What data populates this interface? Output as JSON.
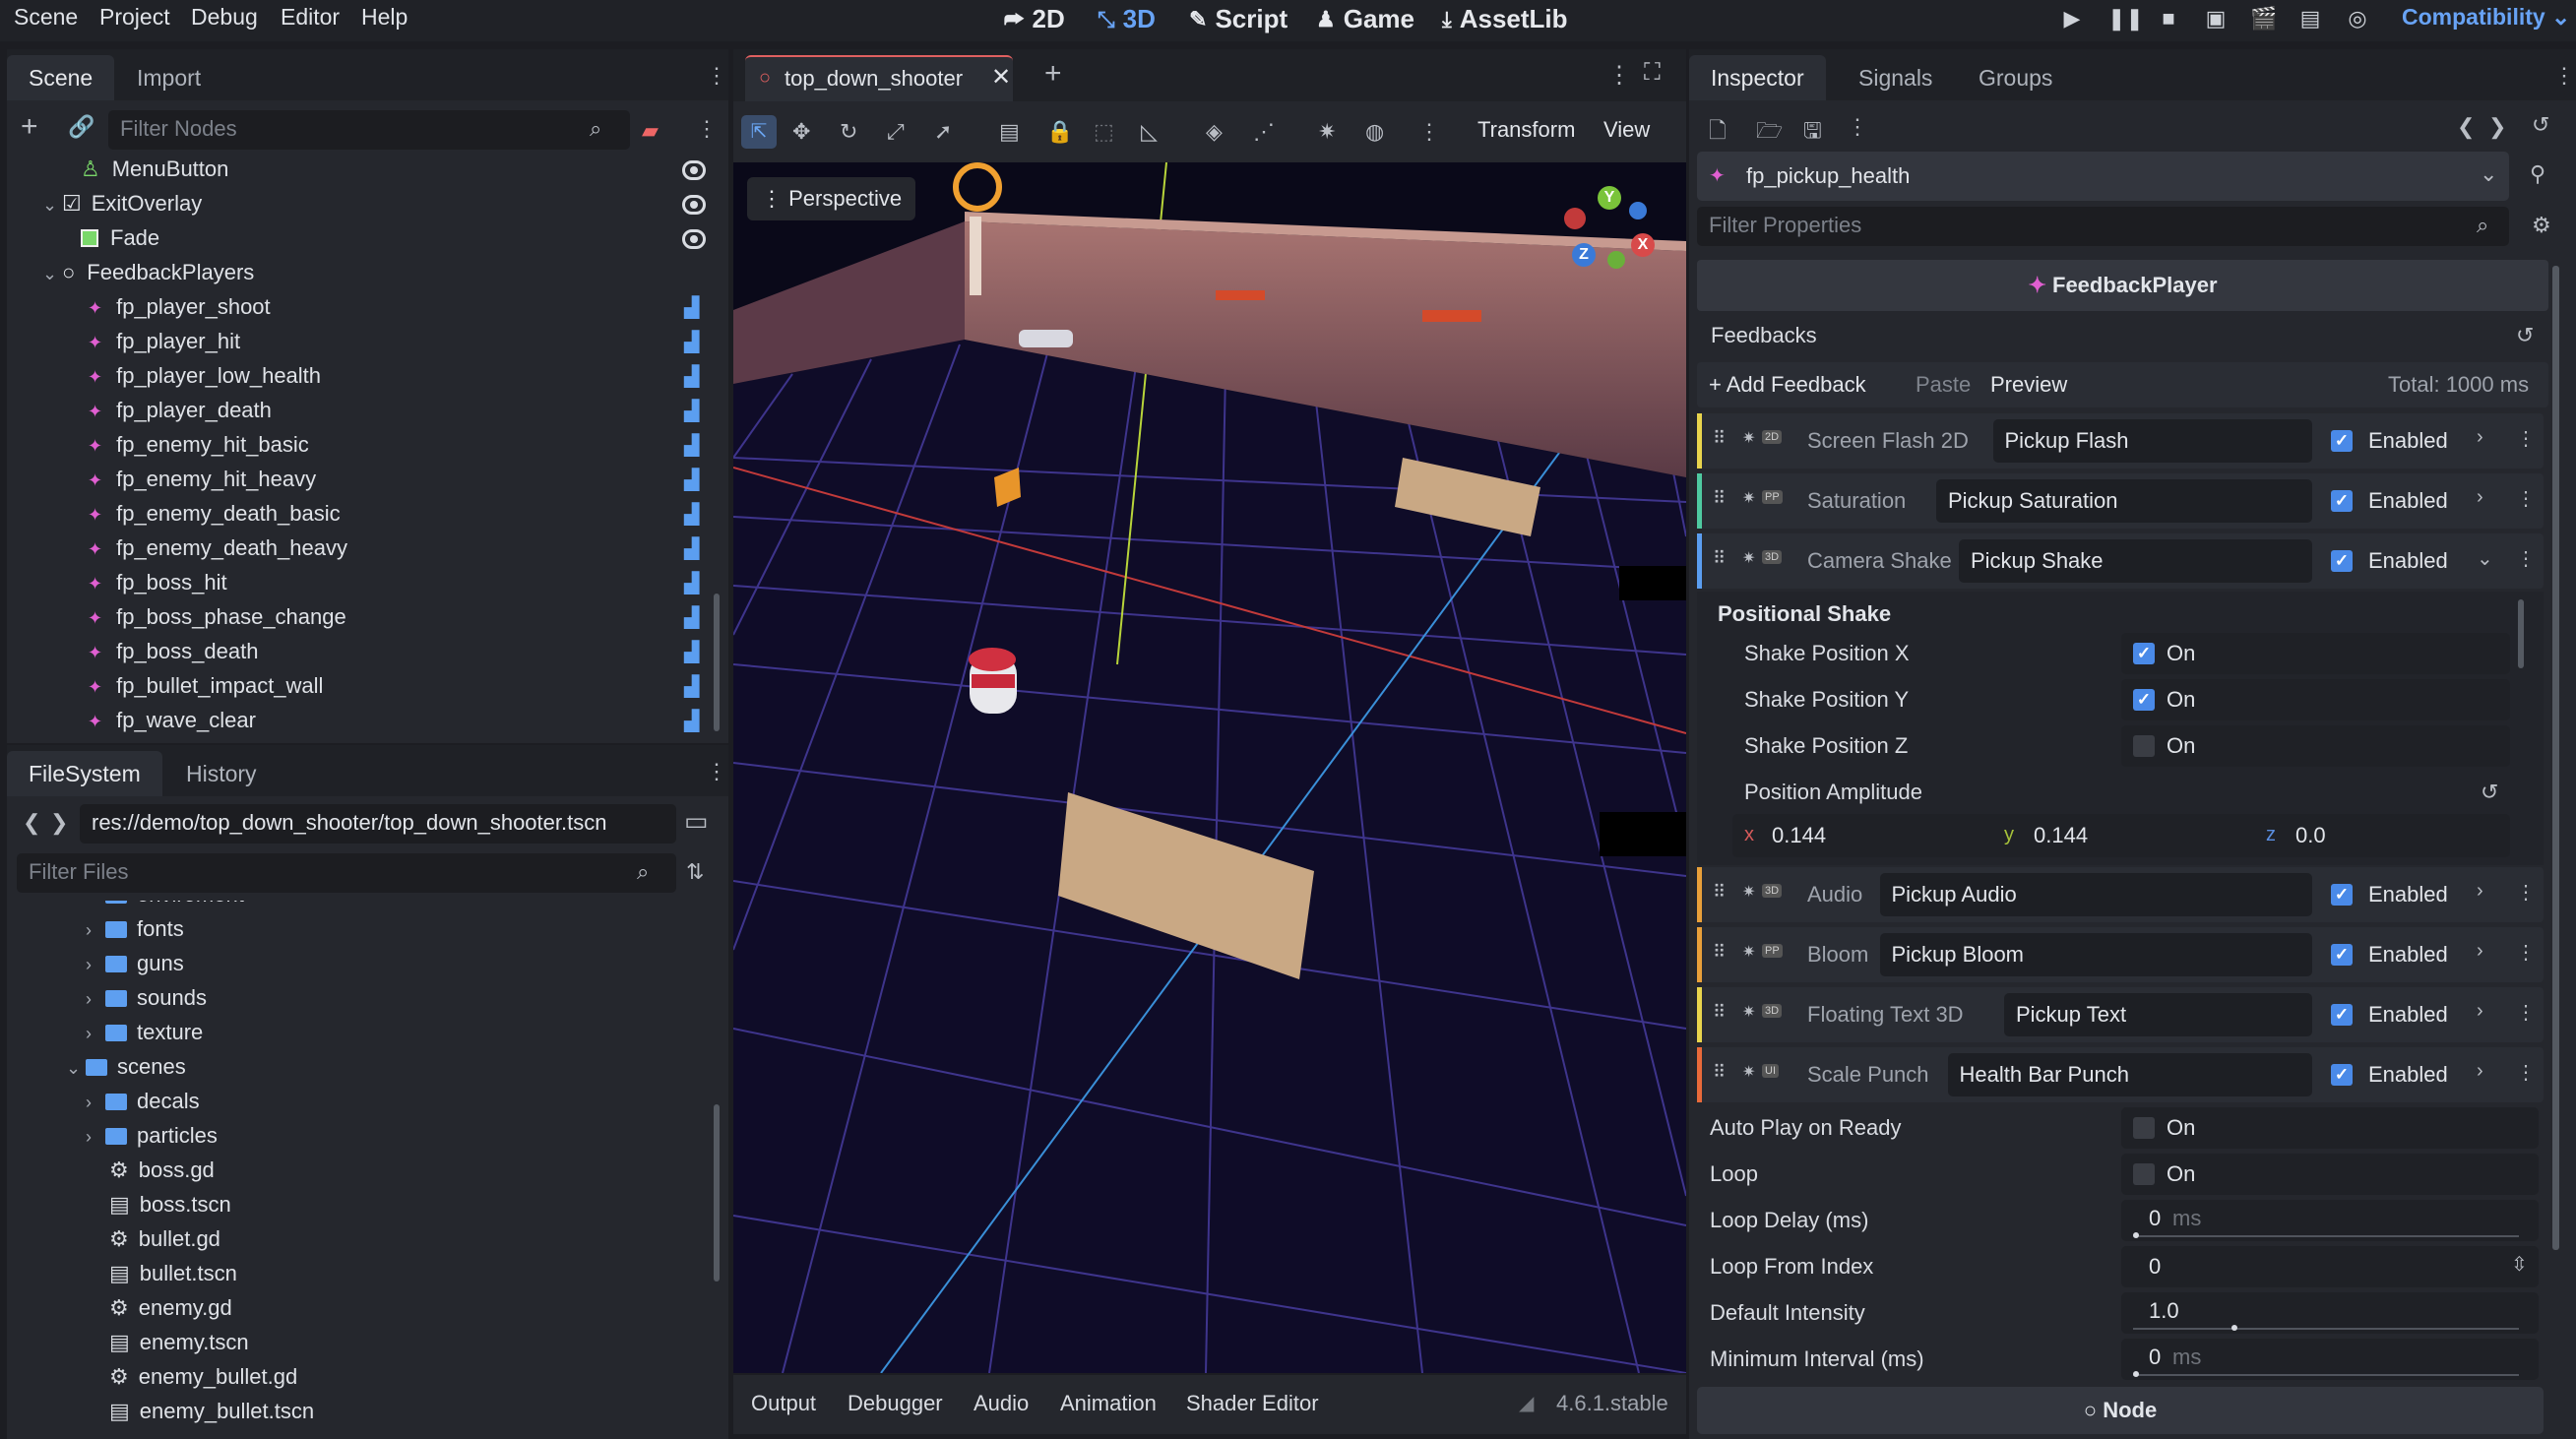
{
  "menu": [
    "Scene",
    "Project",
    "Debug",
    "Editor",
    "Help"
  ],
  "workspaces": [
    {
      "label": "2D",
      "icon": "2d-icon",
      "active": false
    },
    {
      "label": "3D",
      "icon": "3d-icon",
      "active": true
    },
    {
      "label": "Script",
      "icon": "script-icon",
      "active": false
    },
    {
      "label": "Game",
      "icon": "game-icon",
      "active": false
    },
    {
      "label": "AssetLib",
      "icon": "assetlib-icon",
      "active": false
    }
  ],
  "renderer": "Compatibility",
  "scene_dock": {
    "tabs": [
      "Scene",
      "Import"
    ],
    "filter_placeholder": "Filter Nodes",
    "nodes": [
      {
        "label": "MenuButton",
        "type": "menubutton",
        "indent": 1
      },
      {
        "label": "ExitOverlay",
        "type": "overlay",
        "indent": 0
      },
      {
        "label": "Fade",
        "type": "fade",
        "indent": 1
      },
      {
        "label": "FeedbackPlayers",
        "type": "group",
        "indent": 0
      },
      {
        "label": "fp_player_shoot",
        "type": "fp"
      },
      {
        "label": "fp_player_hit",
        "type": "fp"
      },
      {
        "label": "fp_player_low_health",
        "type": "fp"
      },
      {
        "label": "fp_player_death",
        "type": "fp"
      },
      {
        "label": "fp_enemy_hit_basic",
        "type": "fp"
      },
      {
        "label": "fp_enemy_hit_heavy",
        "type": "fp"
      },
      {
        "label": "fp_enemy_death_basic",
        "type": "fp"
      },
      {
        "label": "fp_enemy_death_heavy",
        "type": "fp"
      },
      {
        "label": "fp_boss_hit",
        "type": "fp"
      },
      {
        "label": "fp_boss_phase_change",
        "type": "fp"
      },
      {
        "label": "fp_boss_death",
        "type": "fp"
      },
      {
        "label": "fp_bullet_impact_wall",
        "type": "fp"
      },
      {
        "label": "fp_wave_clear",
        "type": "fp"
      }
    ]
  },
  "filesystem": {
    "tabs": [
      "FileSystem",
      "History"
    ],
    "path": "res://demo/top_down_shooter/top_down_shooter.tscn",
    "filter_placeholder": "Filter Files",
    "items": [
      {
        "label": "enviroment",
        "kind": "folder",
        "indent": 1
      },
      {
        "label": "fonts",
        "kind": "folder",
        "indent": 1
      },
      {
        "label": "guns",
        "kind": "folder",
        "indent": 1
      },
      {
        "label": "sounds",
        "kind": "folder",
        "indent": 1
      },
      {
        "label": "texture",
        "kind": "folder",
        "indent": 1
      },
      {
        "label": "scenes",
        "kind": "folder-open",
        "indent": 0
      },
      {
        "label": "decals",
        "kind": "folder",
        "indent": 1
      },
      {
        "label": "particles",
        "kind": "folder",
        "indent": 1
      },
      {
        "label": "boss.gd",
        "kind": "gd",
        "indent": 1
      },
      {
        "label": "boss.tscn",
        "kind": "tscn",
        "indent": 1
      },
      {
        "label": "bullet.gd",
        "kind": "gd",
        "indent": 1
      },
      {
        "label": "bullet.tscn",
        "kind": "tscn",
        "indent": 1
      },
      {
        "label": "enemy.gd",
        "kind": "gd",
        "indent": 1
      },
      {
        "label": "enemy.tscn",
        "kind": "tscn",
        "indent": 1
      },
      {
        "label": "enemy_bullet.gd",
        "kind": "gd",
        "indent": 1
      },
      {
        "label": "enemy_bullet.tscn",
        "kind": "tscn",
        "indent": 1
      }
    ]
  },
  "editor": {
    "scene_tab": "top_down_shooter",
    "toolbar_menus": [
      "Transform",
      "View"
    ],
    "perspective_label": "Perspective",
    "gizmo_axes": [
      "Y",
      "Z",
      "X"
    ],
    "bottom_tabs": [
      "Output",
      "Debugger",
      "Audio",
      "Animation",
      "Shader Editor"
    ],
    "version": "4.6.1.stable"
  },
  "inspector": {
    "tabs": [
      "Inspector",
      "Signals",
      "Groups"
    ],
    "node_name": "fp_pickup_health",
    "filter_placeholder": "Filter Properties",
    "class_name": "FeedbackPlayer",
    "feedbacks_label": "Feedbacks",
    "add_feedback": "+ Add Feedback",
    "paste": "Paste",
    "preview": "Preview",
    "total": "Total: 1000 ms",
    "feedbacks": [
      {
        "type": "Screen Flash 2D",
        "name": "Pickup Flash",
        "enabled": "Enabled",
        "color": "#e8d44d",
        "badge": "2D"
      },
      {
        "type": "Saturation",
        "name": "Pickup Saturation",
        "enabled": "Enabled",
        "color": "#4fc9a0",
        "badge": "PP"
      },
      {
        "type": "Camera Shake",
        "name": "Pickup Shake",
        "enabled": "Enabled",
        "color": "#5b9ef0",
        "badge": "3D"
      },
      {
        "type": "Audio",
        "name": "Pickup Audio",
        "enabled": "Enabled",
        "color": "#e8a03a",
        "badge": "3D"
      },
      {
        "type": "Bloom",
        "name": "Pickup Bloom",
        "enabled": "Enabled",
        "color": "#e8a03a",
        "badge": "PP"
      },
      {
        "type": "Floating Text 3D",
        "name": "Pickup Text",
        "enabled": "Enabled",
        "color": "#e8d44d",
        "badge": "3D"
      },
      {
        "type": "Scale Punch",
        "name": "Health Bar Punch",
        "enabled": "Enabled",
        "color": "#e86a3a",
        "badge": "UI"
      }
    ],
    "positional_shake": {
      "header": "Positional Shake",
      "rows": [
        {
          "label": "Shake Position X",
          "value": "On",
          "checked": true
        },
        {
          "label": "Shake Position Y",
          "value": "On",
          "checked": true
        },
        {
          "label": "Shake Position Z",
          "value": "On",
          "checked": false
        }
      ],
      "amplitude_label": "Position Amplitude",
      "amplitude": {
        "x": "0.144",
        "y": "0.144",
        "z": "0.0"
      }
    },
    "props": [
      {
        "label": "Auto Play on Ready",
        "value": "On",
        "kind": "check"
      },
      {
        "label": "Loop",
        "value": "On",
        "kind": "check"
      },
      {
        "label": "Loop Delay (ms)",
        "value": "0",
        "unit": "ms",
        "kind": "slider"
      },
      {
        "label": "Loop From Index",
        "value": "0",
        "kind": "spin"
      },
      {
        "label": "Default Intensity",
        "value": "1.0",
        "kind": "slider"
      },
      {
        "label": "Minimum Interval (ms)",
        "value": "0",
        "unit": "ms",
        "kind": "slider"
      }
    ],
    "node_button": "Node"
  }
}
